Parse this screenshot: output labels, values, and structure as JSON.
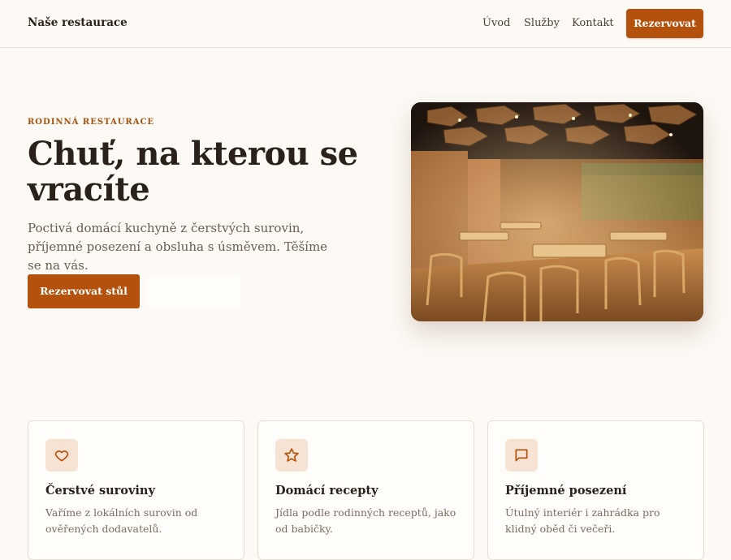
{
  "header": {
    "brand": "Naše restaurace",
    "nav": [
      "Úvod",
      "Služby",
      "Kontakt"
    ],
    "cta": "Rezervovat"
  },
  "hero": {
    "eyebrow": "RODINNÁ RESTAURACE",
    "title": "Chuť, na kterou se vracíte",
    "text": "Poctivá domácí kuchyně z čerstvých surovin, příjemné posezení a obsluha s úsměvem. Těšíme se na vás.",
    "primary_button": "Rezervovat stůl",
    "secondary_button": "",
    "image_alt": "restaurant-interior"
  },
  "features": [
    {
      "icon": "heart-icon",
      "title": "Čerstvé suroviny",
      "text": "Vaříme z lokálních surovin od ověřených dodavatelů."
    },
    {
      "icon": "star-icon",
      "title": "Domácí recepty",
      "text": "Jídla podle rodinných receptů, jako od babičky."
    },
    {
      "icon": "chat-icon",
      "title": "Příjemné posezení",
      "text": "Útulný interiér i zahrádka pro klidný oběd či večeři."
    }
  ],
  "colors": {
    "accent": "#b4520d",
    "background": "#fdf9f4",
    "icon_bg": "#f6e3d4"
  }
}
